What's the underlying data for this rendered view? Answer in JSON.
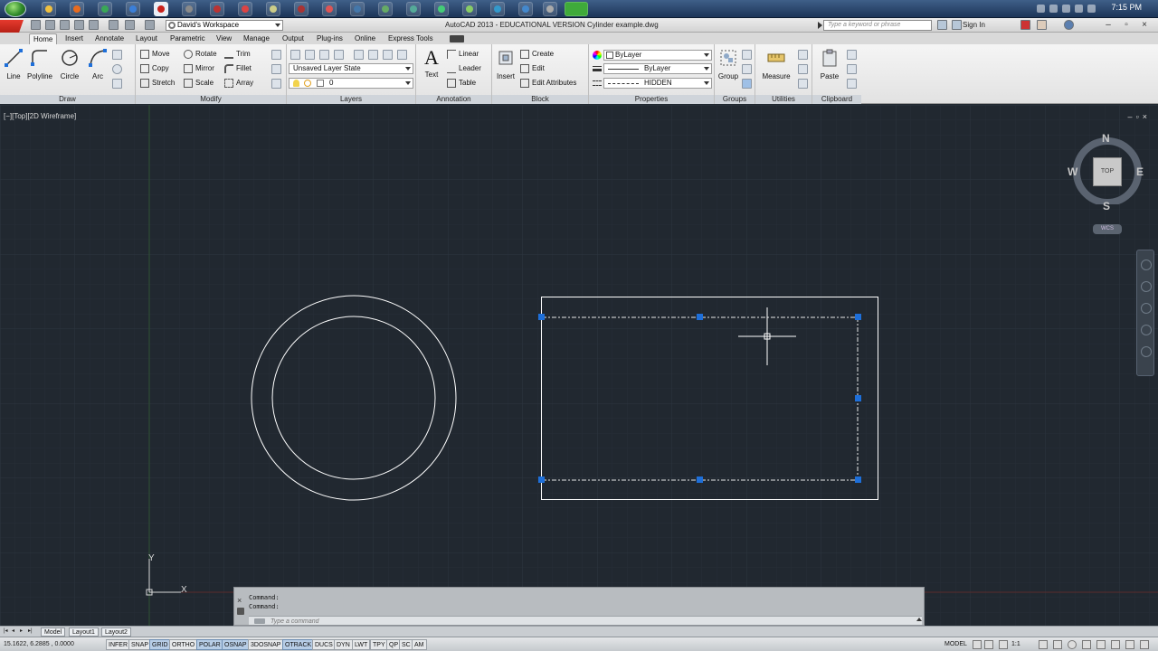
{
  "taskbar": {
    "clock": "7:15 PM"
  },
  "titlebar": {
    "workspace": "David's Workspace",
    "title": "AutoCAD 2013 - EDUCATIONAL VERSION    Cylinder example.dwg",
    "search_placeholder": "Type a keyword or phrase",
    "signin": "Sign In"
  },
  "ribbon_tabs": [
    "Home",
    "Insert",
    "Annotate",
    "Layout",
    "Parametric",
    "View",
    "Manage",
    "Output",
    "Plug-ins",
    "Online",
    "Express Tools"
  ],
  "ribbon": {
    "draw": {
      "title": "Draw",
      "line": "Line",
      "polyline": "Polyline",
      "circle": "Circle",
      "arc": "Arc"
    },
    "modify": {
      "title": "Modify",
      "move": "Move",
      "copy": "Copy",
      "stretch": "Stretch",
      "rotate": "Rotate",
      "mirror": "Mirror",
      "scale": "Scale",
      "trim": "Trim",
      "fillet": "Fillet",
      "array": "Array"
    },
    "layers": {
      "title": "Layers",
      "layer_state": "Unsaved Layer State",
      "current_layer": "0"
    },
    "annotation": {
      "title": "Annotation",
      "text": "Text",
      "linear": "Linear",
      "leader": "Leader",
      "table": "Table"
    },
    "block": {
      "title": "Block",
      "insert": "Insert",
      "create": "Create",
      "edit": "Edit",
      "edit_attributes": "Edit Attributes"
    },
    "properties": {
      "title": "Properties",
      "color": "ByLayer",
      "lineweight": "ByLayer",
      "linetype": "HIDDEN"
    },
    "groups": {
      "title": "Groups",
      "group": "Group"
    },
    "utilities": {
      "title": "Utilities",
      "measure": "Measure"
    },
    "clipboard": {
      "title": "Clipboard",
      "paste": "Paste"
    }
  },
  "viewport": {
    "label": "[−][Top][2D Wireframe]",
    "viewcube": {
      "n": "N",
      "s": "S",
      "e": "E",
      "w": "W",
      "top": "TOP",
      "wcs": "WCS"
    },
    "ucs_x": "X",
    "ucs_y": "Y"
  },
  "command": {
    "history": [
      "Command:",
      "Command:"
    ],
    "placeholder": "Type a command"
  },
  "layout_tabs": [
    "Model",
    "Layout1",
    "Layout2"
  ],
  "status": {
    "coords": "15.1622, 6.2885 , 0.0000",
    "toggles": [
      {
        "label": "INFER",
        "on": false
      },
      {
        "label": "SNAP",
        "on": false
      },
      {
        "label": "GRID",
        "on": true
      },
      {
        "label": "ORTHO",
        "on": false
      },
      {
        "label": "POLAR",
        "on": true
      },
      {
        "label": "OSNAP",
        "on": true
      },
      {
        "label": "3DOSNAP",
        "on": false
      },
      {
        "label": "OTRACK",
        "on": true
      },
      {
        "label": "DUCS",
        "on": false
      },
      {
        "label": "DYN",
        "on": false
      },
      {
        "label": "LWT",
        "on": false
      },
      {
        "label": "TPY",
        "on": false
      },
      {
        "label": "QP",
        "on": false
      },
      {
        "label": "SC",
        "on": false
      },
      {
        "label": "AM",
        "on": false
      }
    ],
    "model": "MODEL",
    "scale": "1:1"
  },
  "colors": {
    "canvas": "#212830",
    "grip": "#1e6fd9",
    "geometry": "#ffffff"
  }
}
